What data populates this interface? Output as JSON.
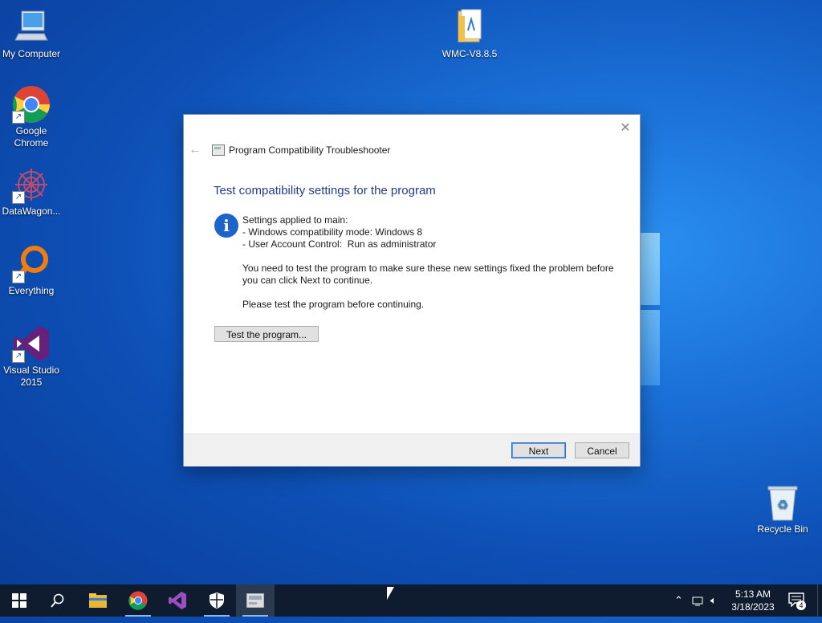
{
  "desktop": {
    "icons": {
      "my_computer": "My Computer",
      "chrome": "Google Chrome",
      "datawagon": "DataWagon...",
      "everything": "Everything",
      "visual_studio": "Visual Studio 2015",
      "wmc": "WMC-V8.8.5",
      "recycle_bin": "Recycle Bin"
    }
  },
  "dialog": {
    "window_title": "Program Compatibility Troubleshooter",
    "heading": "Test compatibility settings for the program",
    "settings_line": "Settings applied to main:",
    "compat_mode": "- Windows compatibility mode: Windows 8",
    "uac": "- User Account Control:  Run as administrator",
    "instruction": "You need to test the program to make sure these new settings fixed the problem before you can click Next to continue.",
    "please_test": "Please test the program before continuing.",
    "test_button": "Test the program...",
    "next_button": "Next",
    "cancel_button": "Cancel"
  },
  "taskbar": {
    "time": "5:13 AM",
    "date": "3/18/2023",
    "notification_count": "4"
  },
  "colors": {
    "heading": "#1e3e8a",
    "info_icon": "#1c64c8",
    "taskbar": "#0f1c30"
  }
}
